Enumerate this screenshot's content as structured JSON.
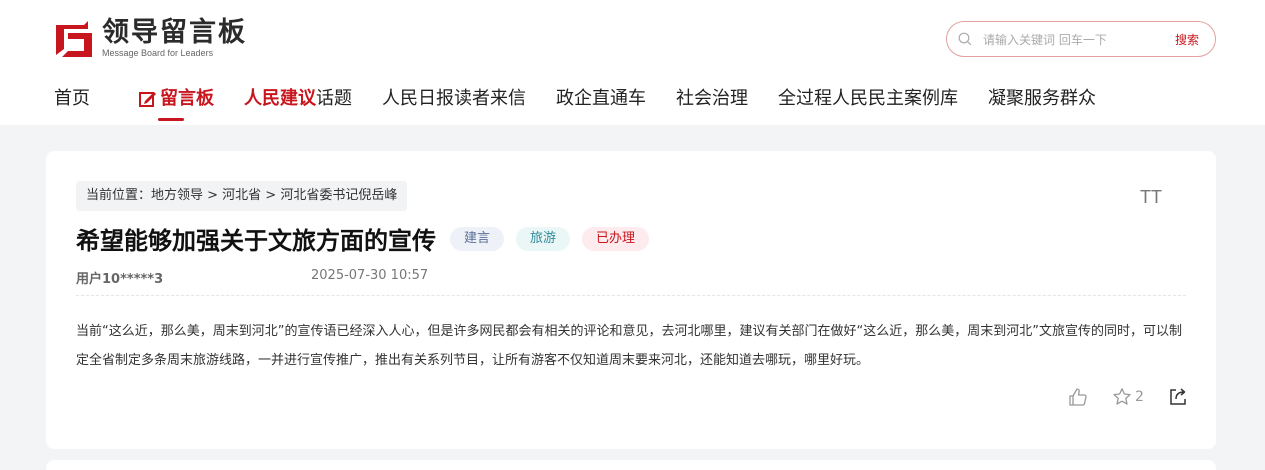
{
  "header": {
    "logo_title": "领导留言板",
    "logo_sub": "Message Board for Leaders",
    "search": {
      "placeholder": "请输入关键词 回车一下",
      "button": "搜索"
    },
    "nav": [
      "首页",
      "留言板",
      "人民建议",
      "话题",
      "人民日报读者来信",
      "政企直通车",
      "社会治理",
      "全过程人民民主案例库",
      "凝聚服务群众"
    ]
  },
  "breadcrumb": "当前位置：地方领导 > 河北省 > 河北省委书记倪岳峰",
  "font_toggle": "TT",
  "post": {
    "title": "希望能够加强关于文旅方面的宣传",
    "tags": [
      "建言",
      "旅游",
      "已办理"
    ],
    "user": "用户10*****3",
    "time": "2025-07-30 10:57",
    "content": "当前“这么近，那么美，周末到河北”的宣传语已经深入人心，但是许多网民都会有相关的评论和意见，去河北哪里，建议有关部门在做好“这么近，那么美，周末到河北”文旅宣传的同时，可以制定全省制定多条周末旅游线路，一并进行宣传推广，推出有关系列节目，让所有游客不仅知道周末要来河北，还能知道去哪玩，哪里好玩。",
    "favorites": "2"
  },
  "colors": {
    "accent": "#c8161e"
  },
  "icons": [
    "search-icon",
    "edit-icon",
    "thumb-up-icon",
    "star-icon",
    "share-icon"
  ]
}
